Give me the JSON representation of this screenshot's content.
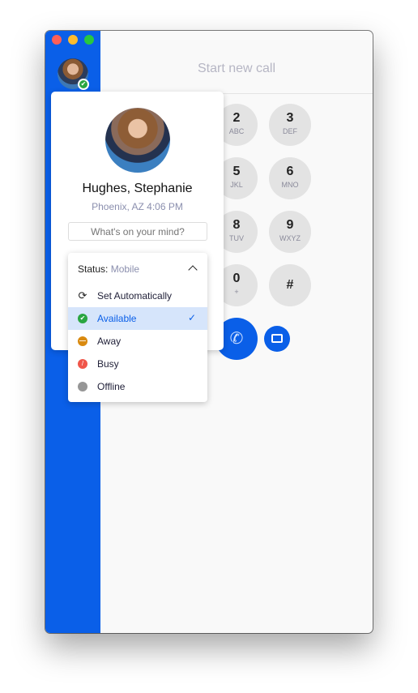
{
  "window": {
    "traffic_lights": [
      "#fe5f57",
      "#febc2e",
      "#28c840"
    ]
  },
  "header": {
    "title": "Start new call"
  },
  "keypad": [
    {
      "digit": "2",
      "letters": "ABC"
    },
    {
      "digit": "3",
      "letters": "DEF"
    },
    {
      "digit": "5",
      "letters": "JKL"
    },
    {
      "digit": "6",
      "letters": "MNO"
    },
    {
      "digit": "8",
      "letters": "TUV"
    },
    {
      "digit": "9",
      "letters": "WXYZ"
    },
    {
      "digit": "0",
      "letters": "+"
    },
    {
      "digit": "#",
      "letters": ""
    }
  ],
  "profile": {
    "name": "Hughes, Stephanie",
    "location": "Phoenix, AZ 4:06 PM",
    "status_placeholder": "What's on your mind?",
    "presence": "available"
  },
  "status_menu": {
    "label": "Status:",
    "current": "Mobile",
    "items": [
      {
        "label": "Set Automatically",
        "icon": "refresh-icon"
      },
      {
        "label": "Available",
        "icon": "check-circle-icon",
        "color": "#2aa641",
        "selected": true
      },
      {
        "label": "Away",
        "icon": "minus-circle-icon",
        "color": "#d98a10"
      },
      {
        "label": "Busy",
        "icon": "slash-circle-icon",
        "color": "#f0564a"
      },
      {
        "label": "Offline",
        "icon": "circle-icon",
        "color": "#969696"
      }
    ]
  },
  "colors": {
    "accent": "#0a5fe8"
  }
}
